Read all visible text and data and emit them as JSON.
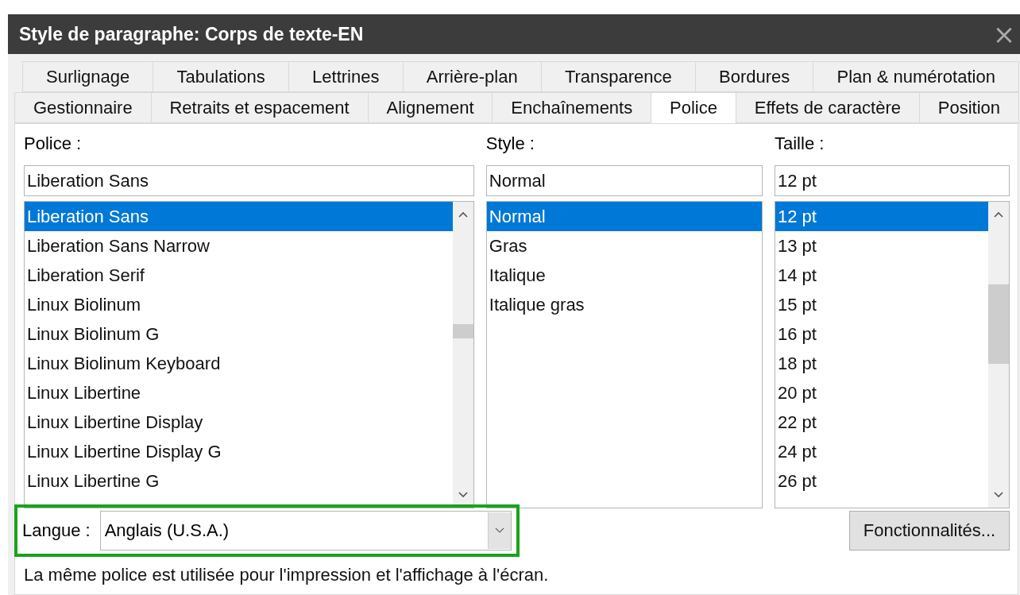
{
  "window": {
    "title": "Style de paragraphe: Corps de texte-EN",
    "close": "×"
  },
  "tab_rows": [
    [
      {
        "label": "Surlignage",
        "selected": false
      },
      {
        "label": "Tabulations",
        "selected": false
      },
      {
        "label": "Lettrines",
        "selected": false
      },
      {
        "label": "Arrière-plan",
        "selected": false
      },
      {
        "label": "Transparence",
        "selected": false
      },
      {
        "label": "Bordures",
        "selected": false
      },
      {
        "label": "Plan & numérotation",
        "selected": false
      }
    ],
    [
      {
        "label": "Gestionnaire",
        "selected": false
      },
      {
        "label": "Retraits et espacement",
        "selected": false
      },
      {
        "label": "Alignement",
        "selected": false
      },
      {
        "label": "Enchaînements",
        "selected": false
      },
      {
        "label": "Police",
        "selected": true
      },
      {
        "label": "Effets de caractère",
        "selected": false
      },
      {
        "label": "Position",
        "selected": false
      }
    ]
  ],
  "columns": [
    {
      "kind": "font",
      "label": "Police :",
      "value": "Liberation Sans",
      "scrollbar": true,
      "items": [
        {
          "label": "Liberation Sans",
          "selected": true
        },
        {
          "label": "Liberation Sans Narrow",
          "selected": false
        },
        {
          "label": "Liberation Serif",
          "selected": false
        },
        {
          "label": "Linux Biolinum",
          "selected": false
        },
        {
          "label": "Linux Biolinum G",
          "selected": false
        },
        {
          "label": "Linux Biolinum Keyboard",
          "selected": false
        },
        {
          "label": "Linux Libertine",
          "selected": false
        },
        {
          "label": "Linux Libertine Display",
          "selected": false
        },
        {
          "label": "Linux Libertine Display G",
          "selected": false
        },
        {
          "label": "Linux Libertine G",
          "selected": false
        }
      ]
    },
    {
      "kind": "style",
      "label": "Style :",
      "value": "Normal",
      "scrollbar": false,
      "items": [
        {
          "label": "Normal",
          "selected": true
        },
        {
          "label": "Gras",
          "selected": false
        },
        {
          "label": "Italique",
          "selected": false
        },
        {
          "label": "Italique gras",
          "selected": false
        }
      ]
    },
    {
      "kind": "size",
      "label": "Taille :",
      "value": "12 pt",
      "scrollbar": true,
      "items": [
        {
          "label": "12 pt",
          "selected": true
        },
        {
          "label": "13 pt",
          "selected": false
        },
        {
          "label": "14 pt",
          "selected": false
        },
        {
          "label": "15 pt",
          "selected": false
        },
        {
          "label": "16 pt",
          "selected": false
        },
        {
          "label": "18 pt",
          "selected": false
        },
        {
          "label": "20 pt",
          "selected": false
        },
        {
          "label": "22 pt",
          "selected": false
        },
        {
          "label": "24 pt",
          "selected": false
        },
        {
          "label": "26 pt",
          "selected": false
        }
      ]
    }
  ],
  "language": {
    "label": "Langue :",
    "value": "Anglais (U.S.A.)",
    "highlighted": true
  },
  "features_button": "Fonctionnalités...",
  "note": "La même police est utilisée pour l'impression et l'affichage à l'écran."
}
